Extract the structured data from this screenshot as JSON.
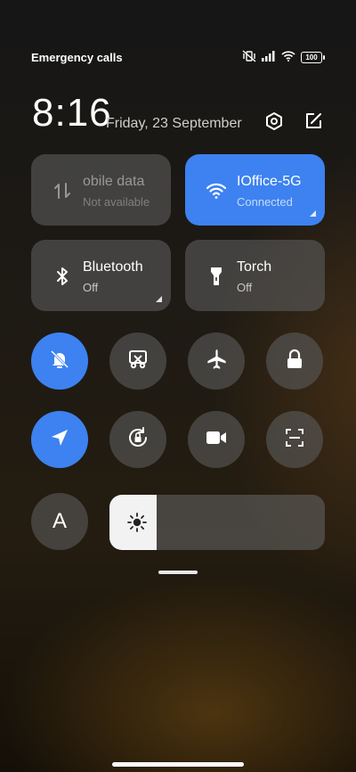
{
  "status_bar": {
    "carrier": "Emergency calls o",
    "battery": "100"
  },
  "header": {
    "time": "8:16",
    "date": "Friday, 23 September"
  },
  "tiles": {
    "mobile_data": {
      "label": "obile data",
      "sub": "Not available"
    },
    "wifi": {
      "label": "IOffice-5G",
      "sub": "Connected"
    },
    "bluetooth": {
      "label": "Bluetooth",
      "sub": "Off"
    },
    "torch": {
      "label": "Torch",
      "sub": "Off"
    }
  },
  "toggles_row1": [
    {
      "name": "silent-toggle",
      "icon": "bell-off-icon",
      "active": true
    },
    {
      "name": "screenshot-toggle",
      "icon": "scissors-icon",
      "active": false
    },
    {
      "name": "airplane-toggle",
      "icon": "airplane-icon",
      "active": false
    },
    {
      "name": "lock-toggle",
      "icon": "lock-icon",
      "active": false
    }
  ],
  "toggles_row2": [
    {
      "name": "location-toggle",
      "icon": "navigation-arrow-icon",
      "active": true
    },
    {
      "name": "auto-rotate-toggle",
      "icon": "rotation-lock-icon",
      "active": false
    },
    {
      "name": "screen-recorder-toggle",
      "icon": "video-camera-icon",
      "active": false
    },
    {
      "name": "scanner-toggle",
      "icon": "scan-icon",
      "active": false
    }
  ],
  "font_toggle": {
    "letter": "A"
  },
  "brightness": {
    "level": 0.22
  },
  "colors": {
    "accent": "#3d82f0",
    "tile": "#5a5a5a"
  }
}
